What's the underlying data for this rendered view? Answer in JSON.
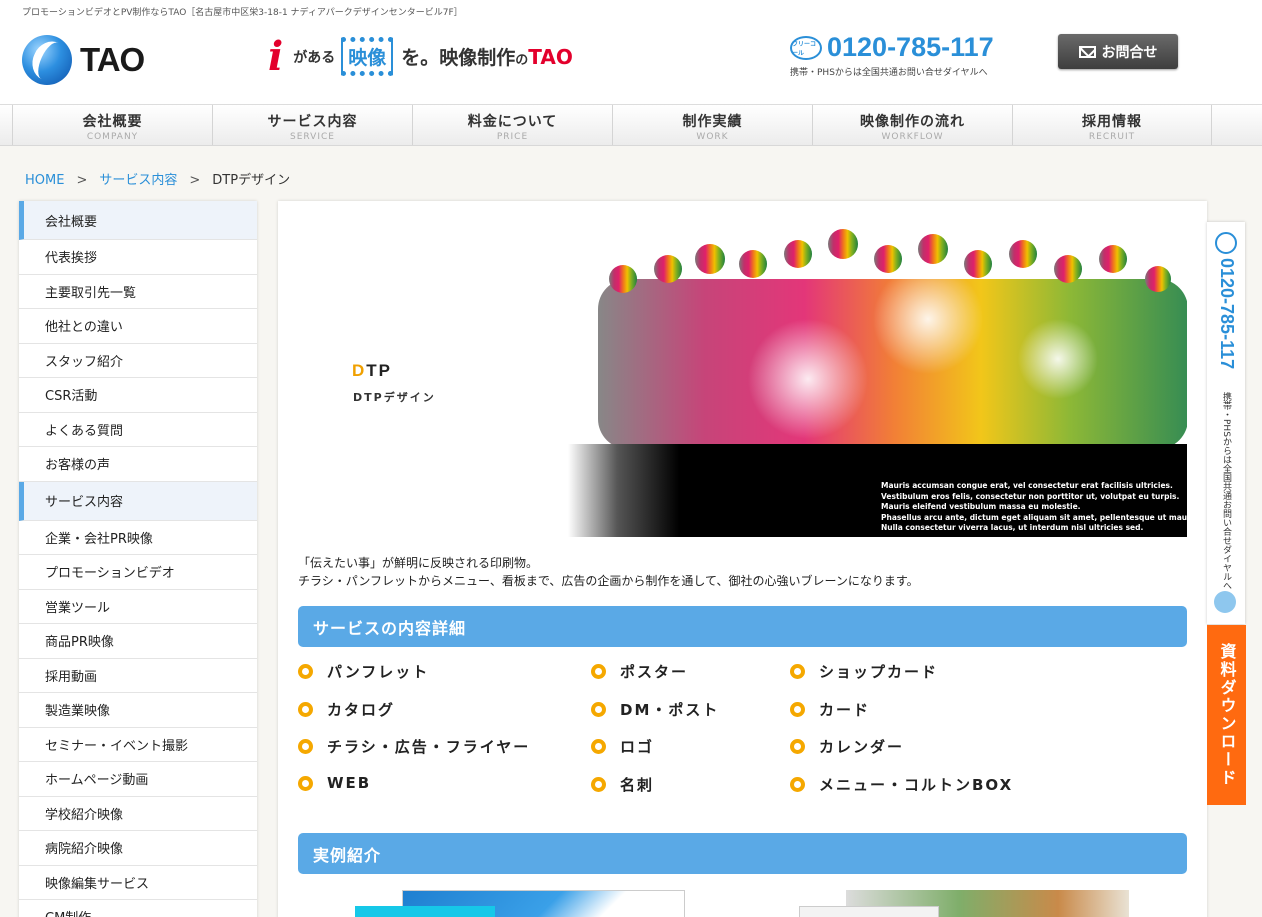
{
  "header": {
    "top_note": "プロモーションビデオとPV制作ならTAO［名古屋市中区栄3-18-1 ナディアパークデザインセンタービル7F］",
    "logo_text": "TAO",
    "catch": {
      "i": "i",
      "a": "がある",
      "b": "映像",
      "c": "を。映像制作",
      "no": "の",
      "d": "TAO"
    },
    "phone_badge": "フリーコール",
    "phone": "0120-785-117",
    "phone_sub": "携帯・PHSからは全国共通お問い合せダイヤルへ",
    "contact_label": "お問合せ"
  },
  "nav": [
    {
      "ja": "会社概要",
      "en": "COMPANY"
    },
    {
      "ja": "サービス内容",
      "en": "SERVICE"
    },
    {
      "ja": "料金について",
      "en": "PRICE"
    },
    {
      "ja": "制作実績",
      "en": "WORK"
    },
    {
      "ja": "映像制作の流れ",
      "en": "WORKFLOW"
    },
    {
      "ja": "採用情報",
      "en": "RECRUIT"
    }
  ],
  "breadcrumb": {
    "home": "HOME",
    "sep": ">",
    "parent": "サービス内容",
    "current": "DTPデザイン"
  },
  "sidebar": {
    "company_head": "会社概要",
    "company_items": [
      "代表挨拶",
      "主要取引先一覧",
      "他社との違い",
      "スタッフ紹介",
      "CSR活動",
      "よくある質問",
      "お客様の声"
    ],
    "service_head": "サービス内容",
    "service_items": [
      "企業・会社PR映像",
      "プロモーションビデオ",
      "営業ツール",
      "商品PR映像",
      "採用動画",
      "製造業映像",
      "セミナー・イベント撮影",
      "ホームページ動画",
      "学校紹介映像",
      "病院紹介映像",
      "映像編集サービス",
      "CM制作"
    ]
  },
  "hero": {
    "title_d": "D",
    "title_rest": "TP",
    "subtitle": "DTPデザイン",
    "lines": [
      "Mauris accumsan congue erat, vel consectetur erat facilisis ultricies.",
      "Vestibulum eros felis, consectetur non porttitor ut, volutpat eu turpis.",
      "Mauris eleifend vestibulum massa eu molestie.",
      "Phasellus arcu ante, dictum eget aliquam sit amet, pellentesque ut mauris.",
      "Nulla consectetur viverra lacus, ut interdum nisl ultricies sed."
    ]
  },
  "lead": {
    "line1": "「伝えたい事」が鮮明に反映される印刷物。",
    "line2": "チラシ・パンフレットからメニュー、看板まで、広告の企画から制作を通して、御社の心強いブレーンになります。"
  },
  "section1_title": "サービスの内容詳細",
  "services": {
    "col1": [
      "パンフレット",
      "カタログ",
      "チラシ・広告・フライヤー",
      "WEB"
    ],
    "col2": [
      "ポスター",
      "DM・ポスト",
      "ロゴ",
      "名刺"
    ],
    "col3": [
      "ショップカード",
      "カード",
      "カレンダー",
      "メニュー・コルトンBOX"
    ]
  },
  "section2_title": "実例紹介",
  "float": {
    "phone": "0120-785-117",
    "phone_sub": "携帯・PHSからは全国共通お問い合せダイヤルへ",
    "download": "資料ダウンロード"
  },
  "colors": {
    "accent": "#5aa9e6",
    "phone": "#2a8fd8",
    "bullet": "#f5a800",
    "download": "#ff6a10"
  }
}
